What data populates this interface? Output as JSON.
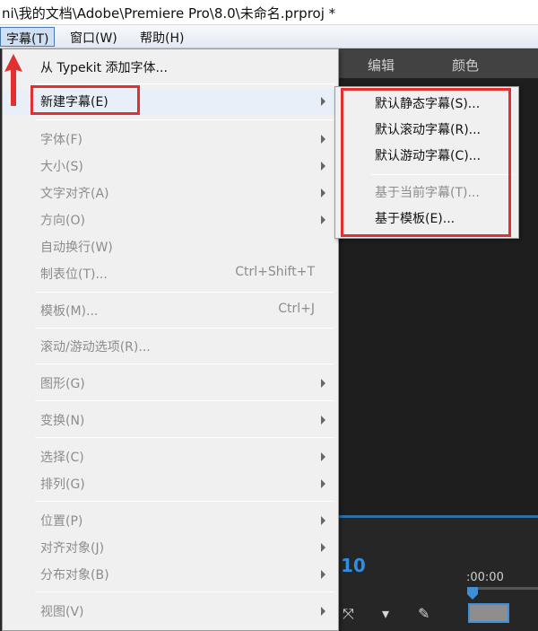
{
  "window": {
    "title": "ni\\我的文档\\Adobe\\Premiere Pro\\8.0\\未命名.prproj *"
  },
  "menubar": {
    "items": [
      {
        "label": "字幕(T)",
        "active": true
      },
      {
        "label": "窗口(W)",
        "active": false
      },
      {
        "label": "帮助(H)",
        "active": false
      }
    ]
  },
  "panel": {
    "tabs": [
      "编辑",
      "颜色"
    ],
    "timecode_big": "10",
    "timecode_small": ":00:00"
  },
  "menu": {
    "items": [
      {
        "label": "从 Typekit 添加字体...",
        "enabled": true,
        "shortcut": "",
        "submenu": false
      },
      {
        "label": "新建字幕(E)",
        "enabled": true,
        "shortcut": "",
        "submenu": true
      },
      {
        "label": "字体(F)",
        "enabled": false,
        "shortcut": "",
        "submenu": true
      },
      {
        "label": "大小(S)",
        "enabled": false,
        "shortcut": "",
        "submenu": true
      },
      {
        "label": "文字对齐(A)",
        "enabled": false,
        "shortcut": "",
        "submenu": true
      },
      {
        "label": "方向(O)",
        "enabled": false,
        "shortcut": "",
        "submenu": true
      },
      {
        "label": "自动换行(W)",
        "enabled": false,
        "shortcut": "",
        "submenu": false
      },
      {
        "label": "制表位(T)...",
        "enabled": false,
        "shortcut": "Ctrl+Shift+T",
        "submenu": false
      },
      {
        "label": "模板(M)...",
        "enabled": false,
        "shortcut": "Ctrl+J",
        "submenu": false
      },
      {
        "label": "滚动/游动选项(R)...",
        "enabled": false,
        "shortcut": "",
        "submenu": false
      },
      {
        "label": "图形(G)",
        "enabled": false,
        "shortcut": "",
        "submenu": true
      },
      {
        "label": "变换(N)",
        "enabled": false,
        "shortcut": "",
        "submenu": true
      },
      {
        "label": "选择(C)",
        "enabled": false,
        "shortcut": "",
        "submenu": true
      },
      {
        "label": "排列(G)",
        "enabled": false,
        "shortcut": "",
        "submenu": true
      },
      {
        "label": "位置(P)",
        "enabled": false,
        "shortcut": "",
        "submenu": true
      },
      {
        "label": "对齐对象(J)",
        "enabled": false,
        "shortcut": "",
        "submenu": true
      },
      {
        "label": "分布对象(B)",
        "enabled": false,
        "shortcut": "",
        "submenu": true
      },
      {
        "label": "视图(V)",
        "enabled": false,
        "shortcut": "",
        "submenu": true
      }
    ]
  },
  "submenu": {
    "items": [
      {
        "label": "默认静态字幕(S)...",
        "enabled": true
      },
      {
        "label": "默认滚动字幕(R)...",
        "enabled": true
      },
      {
        "label": "默认游动字幕(C)...",
        "enabled": true
      },
      {
        "label": "基于当前字幕(T)...",
        "enabled": false
      },
      {
        "label": "基于模板(E)...",
        "enabled": true
      }
    ]
  },
  "colors": {
    "annotation": "#e23030",
    "accent": "#2f8de4"
  }
}
